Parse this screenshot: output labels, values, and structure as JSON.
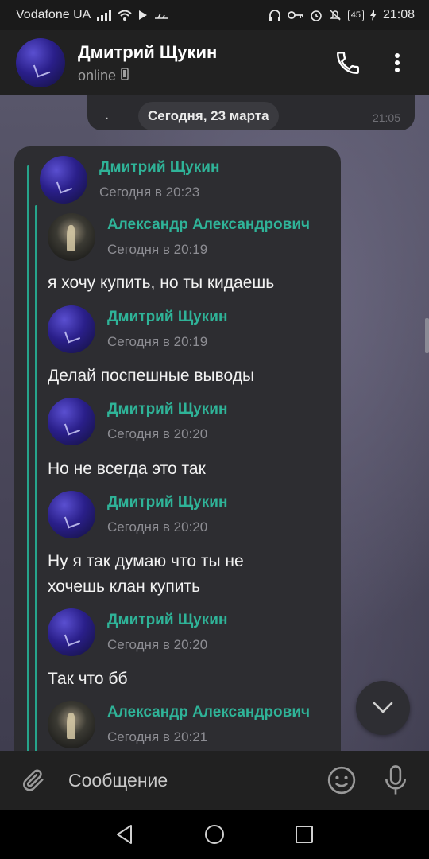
{
  "status_bar": {
    "carrier": "Vodafone UA",
    "battery": "45",
    "time": "21:08",
    "icons": [
      "signal-icon",
      "wifi-icon",
      "play-icon",
      "usb-icon",
      "headset-icon",
      "key-icon",
      "alarm-icon",
      "mute-icon",
      "battery-icon",
      "charging-icon"
    ]
  },
  "header": {
    "name": "Дмитрий Щукин",
    "status": "online"
  },
  "chat": {
    "date_pill": "Сегодня, 23 марта",
    "prev_time": "21:05",
    "prev_dot": "·",
    "outer_sender": {
      "name": "Дмитрий Щукин",
      "time": "Сегодня в 20:23"
    },
    "messages": [
      {
        "sender": "Александр Александрович",
        "time": "Сегодня в 20:19",
        "text": "я хочу купить, но ты кидаешь"
      },
      {
        "sender": "Дмитрий Щукин",
        "time": "Сегодня в 20:19",
        "text": "Делай поспешные выводы"
      },
      {
        "sender": "Дмитрий Щукин",
        "time": "Сегодня в 20:20",
        "text": "Но не всегда это так"
      },
      {
        "sender": "Дмитрий Щукин",
        "time": "Сегодня в 20:20",
        "text": "Ну я так думаю что ты не хочешь клан купить"
      },
      {
        "sender": "Дмитрий Щукин",
        "time": "Сегодня в 20:20",
        "text": "Так что бб"
      },
      {
        "sender": "Александр Александрович",
        "time": "Сегодня в 20:21",
        "text": ""
      }
    ]
  },
  "composer": {
    "placeholder": "Сообщение"
  },
  "colors": {
    "accent": "#2fb398",
    "bubble": "#2d2d31",
    "header": "#212121"
  }
}
